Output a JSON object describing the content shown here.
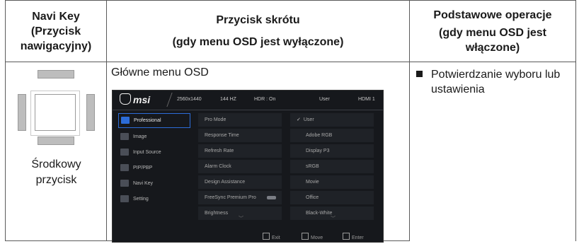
{
  "headers": {
    "col1": [
      "Navi Key",
      "(Przycisk",
      "nawigacyjny)"
    ],
    "col2": [
      "Przycisk skrótu",
      "(gdy menu OSD jest wyłączone)"
    ],
    "col3": [
      "Podstawowe operacje",
      "(gdy menu OSD jest",
      "włączone)"
    ]
  },
  "navi": {
    "label_line1": "Środkowy",
    "label_line2": "przycisk"
  },
  "menu_title": "Główne menu OSD",
  "osd": {
    "logo": "msi",
    "resolution": "2560x1440",
    "refresh": "144 HZ",
    "hdr": "HDR : On",
    "profile": "User",
    "input": "HDMI 1",
    "sidebar": [
      "Professional",
      "Image",
      "Input Source",
      "PIP/PBP",
      "Navi Key",
      "Setting"
    ],
    "middle": [
      "Pro Mode",
      "Response Time",
      "Refresh Rate",
      "Alarm Clock",
      "Design Assistance",
      "FreeSync Premium Pro",
      "Brightness"
    ],
    "right": [
      "User",
      "Adobe RGB",
      "Display P3",
      "sRGB",
      "Movie",
      "Office",
      "Black-White"
    ],
    "bottom": [
      "Exit",
      "Move",
      "Enter"
    ]
  },
  "operation": "Potwierdzanie wyboru lub ustawienia"
}
